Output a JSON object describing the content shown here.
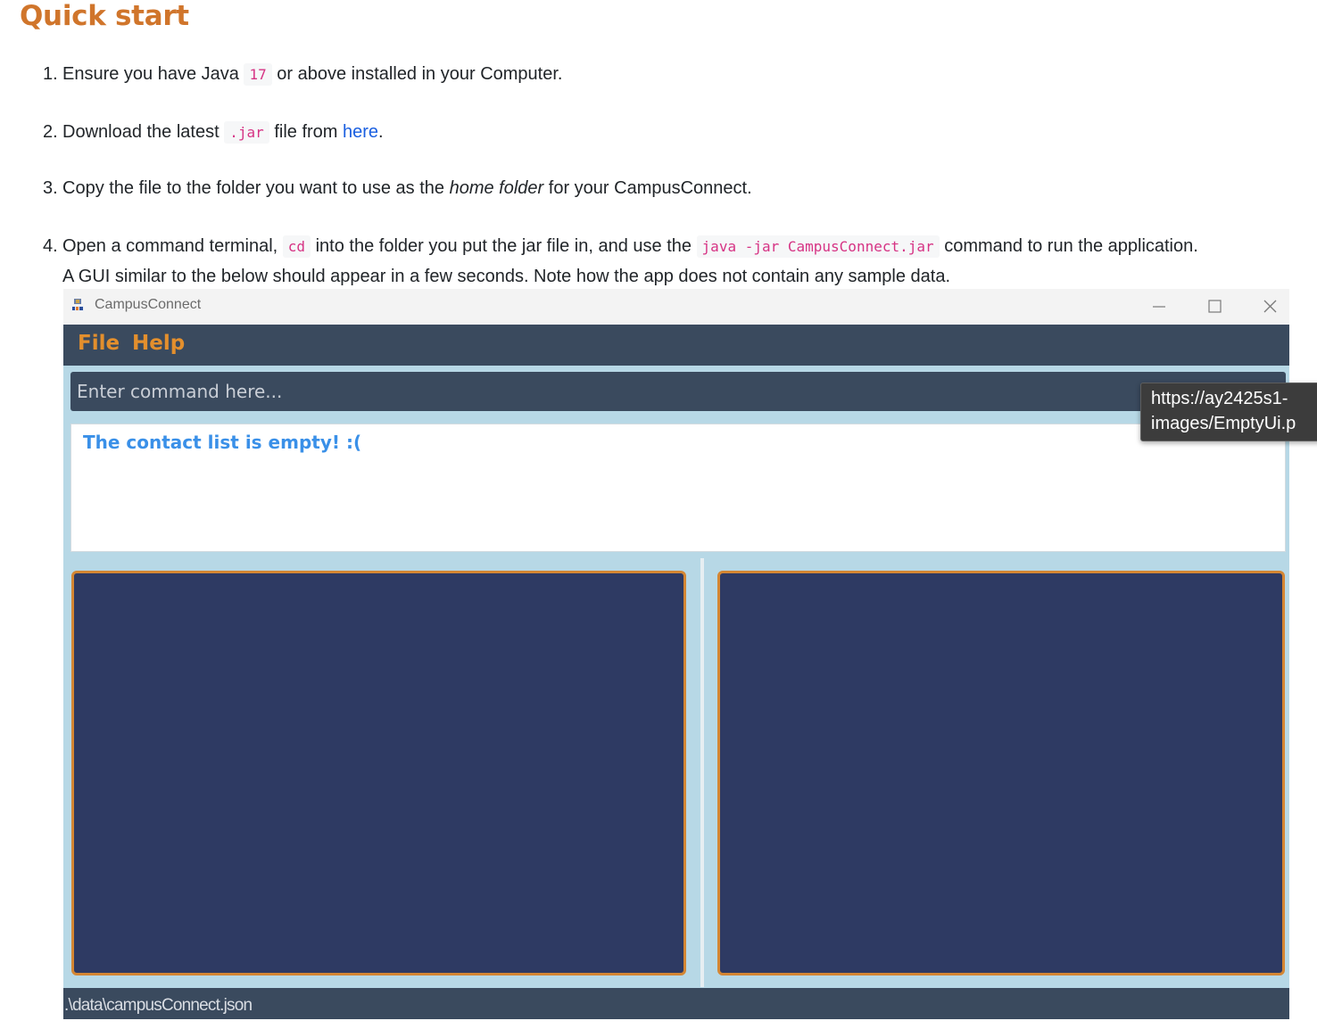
{
  "doc": {
    "title": "Quick start",
    "steps": [
      {
        "num": "1.",
        "before": "Ensure you have Java ",
        "code": "17",
        "after": " or above installed in your Computer."
      },
      {
        "num": "2.",
        "before": "Download the latest ",
        "code": ".jar",
        "mid": " file from ",
        "link": "here",
        "after": "."
      },
      {
        "num": "3.",
        "before": "Copy the file to the folder you want to use as the ",
        "em": "home folder",
        "after": " for your CampusConnect."
      },
      {
        "num": "4.",
        "before": "Open a command terminal, ",
        "code1": "cd",
        "mid": " into the folder you put the jar file in, and use the ",
        "code2": "java -jar CampusConnect.jar",
        "after": " command to run the application.",
        "line2": "A GUI similar to the below should appear in a few seconds. Note how the app does not contain any sample data."
      }
    ]
  },
  "app": {
    "window_title": "CampusConnect",
    "menu": {
      "file": "File",
      "help": "Help"
    },
    "command": {
      "placeholder": "Enter command here..."
    },
    "result": {
      "message": "The contact list is empty! :("
    },
    "status": {
      "path": ".\\data\\campusConnect.json"
    },
    "colors": {
      "accent": "#e38f2d",
      "menubar": "#3a4a5e",
      "pane": "#2e3a63",
      "result_text": "#3a90e8"
    }
  },
  "tooltip": {
    "line1": "https://ay2425s1-",
    "line2": "images/EmptyUi.p"
  }
}
